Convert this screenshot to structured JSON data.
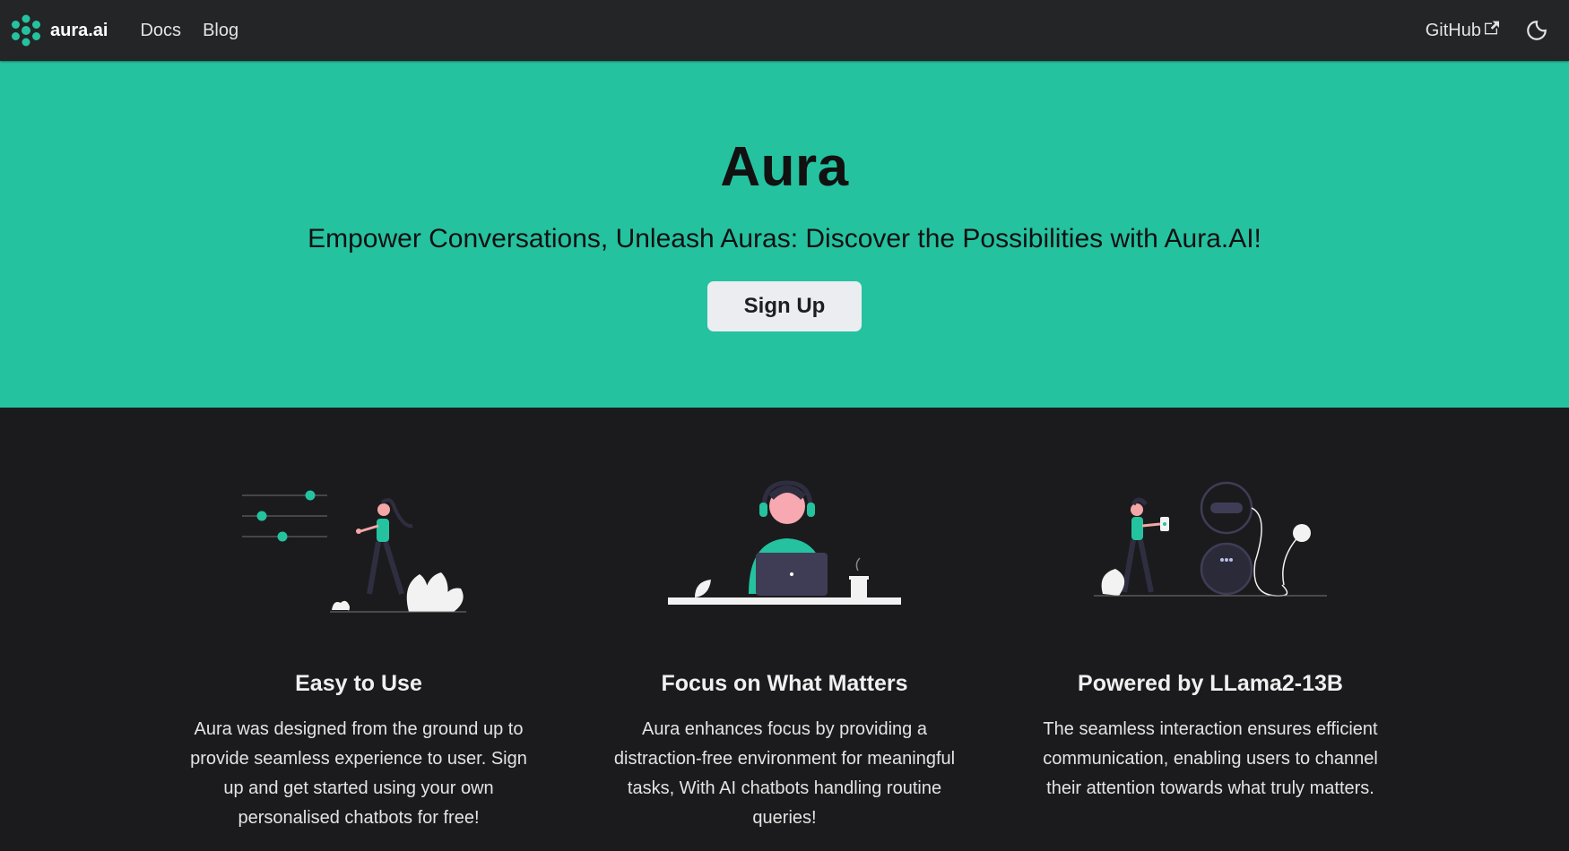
{
  "nav": {
    "brand": "aura.ai",
    "links": [
      "Docs",
      "Blog"
    ],
    "github": "GitHub"
  },
  "hero": {
    "title": "Aura",
    "subtitle": "Empower Conversations, Unleash Auras: Discover the Possibilities with Aura.AI!",
    "cta": "Sign Up"
  },
  "features": [
    {
      "title": "Easy to Use",
      "description": "Aura was designed from the ground up to provide seamless experience to user. Sign up and get started using your own personalised chatbots for free!",
      "icon": "woman-walking-illustration"
    },
    {
      "title": "Focus on What Matters",
      "description": "Aura enhances focus by providing a distraction-free environment for meaningful tasks, With AI chatbots handling routine queries!",
      "icon": "person-at-laptop-illustration"
    },
    {
      "title": "Powered by LLama2-13B",
      "description": "The seamless interaction ensures efficient communication, enabling users to channel their attention towards what truly matters.",
      "icon": "woman-and-robot-illustration"
    }
  ],
  "colors": {
    "accent": "#25c2a0",
    "navbar": "#242526",
    "background": "#1b1b1d"
  }
}
